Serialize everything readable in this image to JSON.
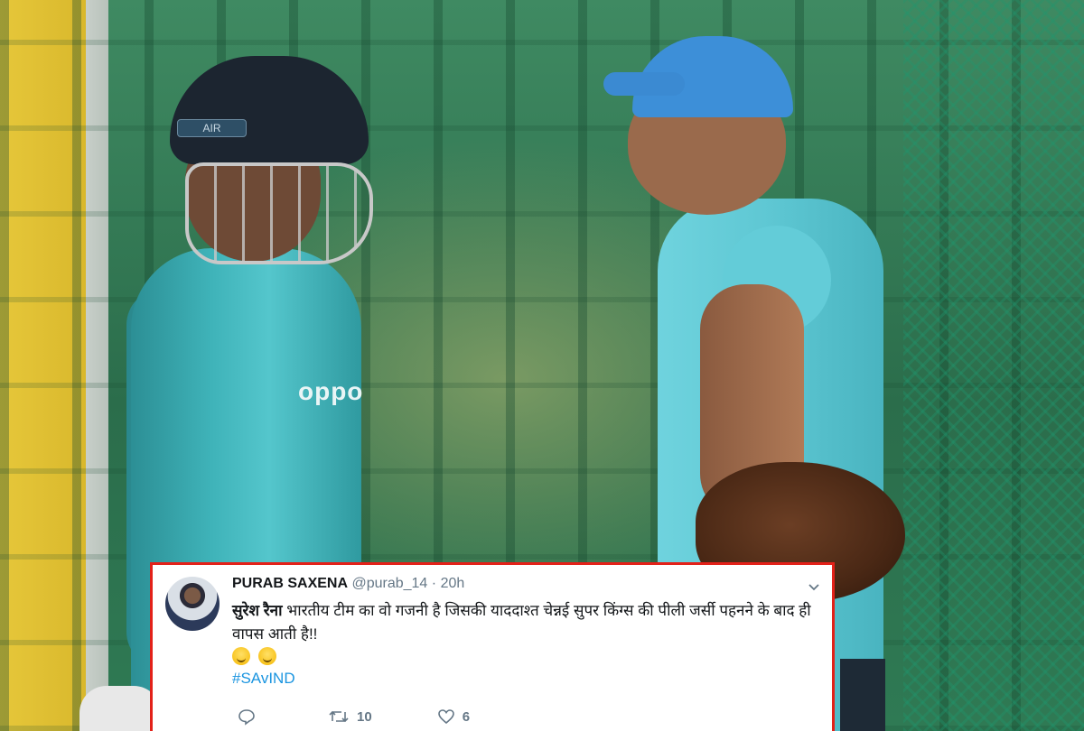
{
  "photo": {
    "helmet_label": "AIR",
    "jersey_sponsor": "oppo"
  },
  "tweet": {
    "author_name": "PURAB SAXENA",
    "handle": "@purab_14",
    "separator": "·",
    "time": "20h",
    "body_bold": "सुरेश रैना",
    "body_text": " भारतीय टीम का वो गजनी है जिसकी याददाश्त चेन्नई सुपर किंग्स की पीली जर्सी पहनने के बाद ही वापस आती है!!",
    "emojis": [
      "grinning-face-emoji",
      "winking-face-emoji"
    ],
    "hashtag": "#SAvIND",
    "actions": {
      "reply_icon": "reply-icon",
      "retweet_icon": "retweet-icon",
      "retweet_count": "10",
      "like_icon": "heart-icon",
      "like_count": "6"
    },
    "colors": {
      "border": "#e32119",
      "link": "#1b95e0",
      "muted": "#657786"
    }
  }
}
